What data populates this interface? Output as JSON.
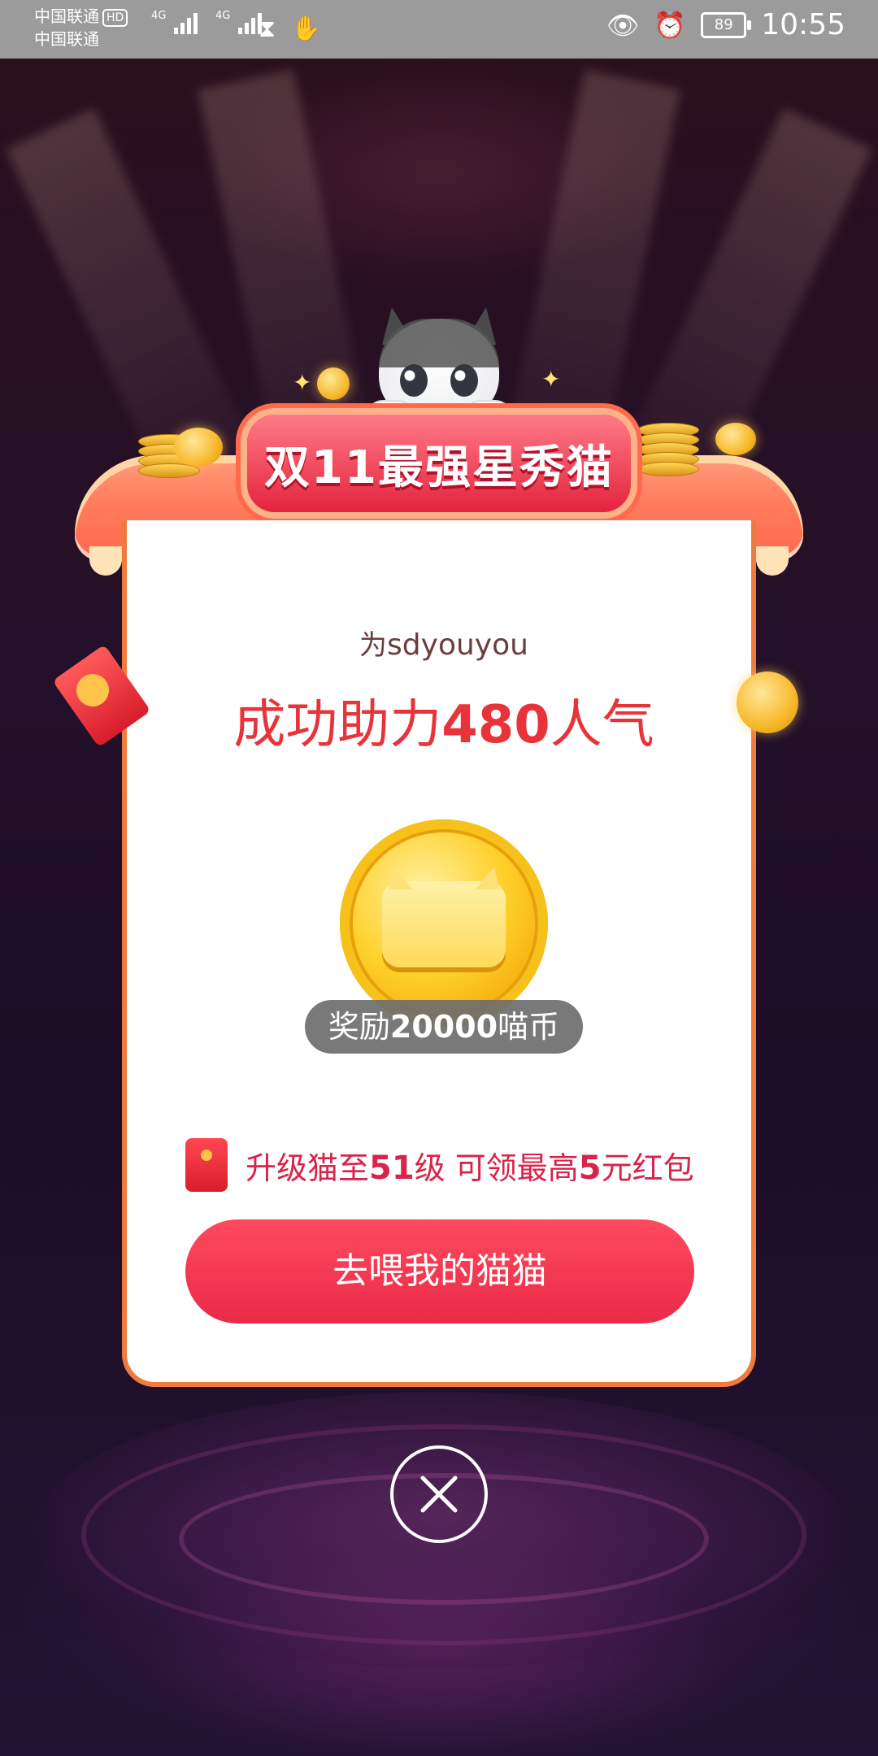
{
  "status_bar": {
    "carrier_1": "中国联通",
    "carrier_2": "中国联通",
    "hd": "HD",
    "network_1": "4G",
    "network_2": "4G",
    "battery": "89",
    "time": "10:55",
    "icons": [
      "hd-icon",
      "signal-icon",
      "signal-icon",
      "hourglass-icon",
      "hand-icon",
      "eye-icon",
      "alarm-icon",
      "battery-icon"
    ]
  },
  "popup": {
    "title": "双11最强星秀猫",
    "for_prefix": "为",
    "username": "sdyouyou",
    "success_prefix": "成功助力",
    "popularity": "480",
    "success_suffix": "人气",
    "reward_prefix": "奖励",
    "reward_amount": "20000",
    "reward_suffix": "喵币",
    "upgrade_prefix": "升级猫至",
    "upgrade_level": "51",
    "upgrade_mid": "级 可领最高",
    "upgrade_amount": "5",
    "upgrade_suffix": "元红包",
    "cta_label": "去喂我的猫猫"
  },
  "colors": {
    "accent_red": "#e8333a",
    "cta_red": "#ff4a5e",
    "card_border": "#f07a3d",
    "pill_gray": "#6e6e6e"
  }
}
